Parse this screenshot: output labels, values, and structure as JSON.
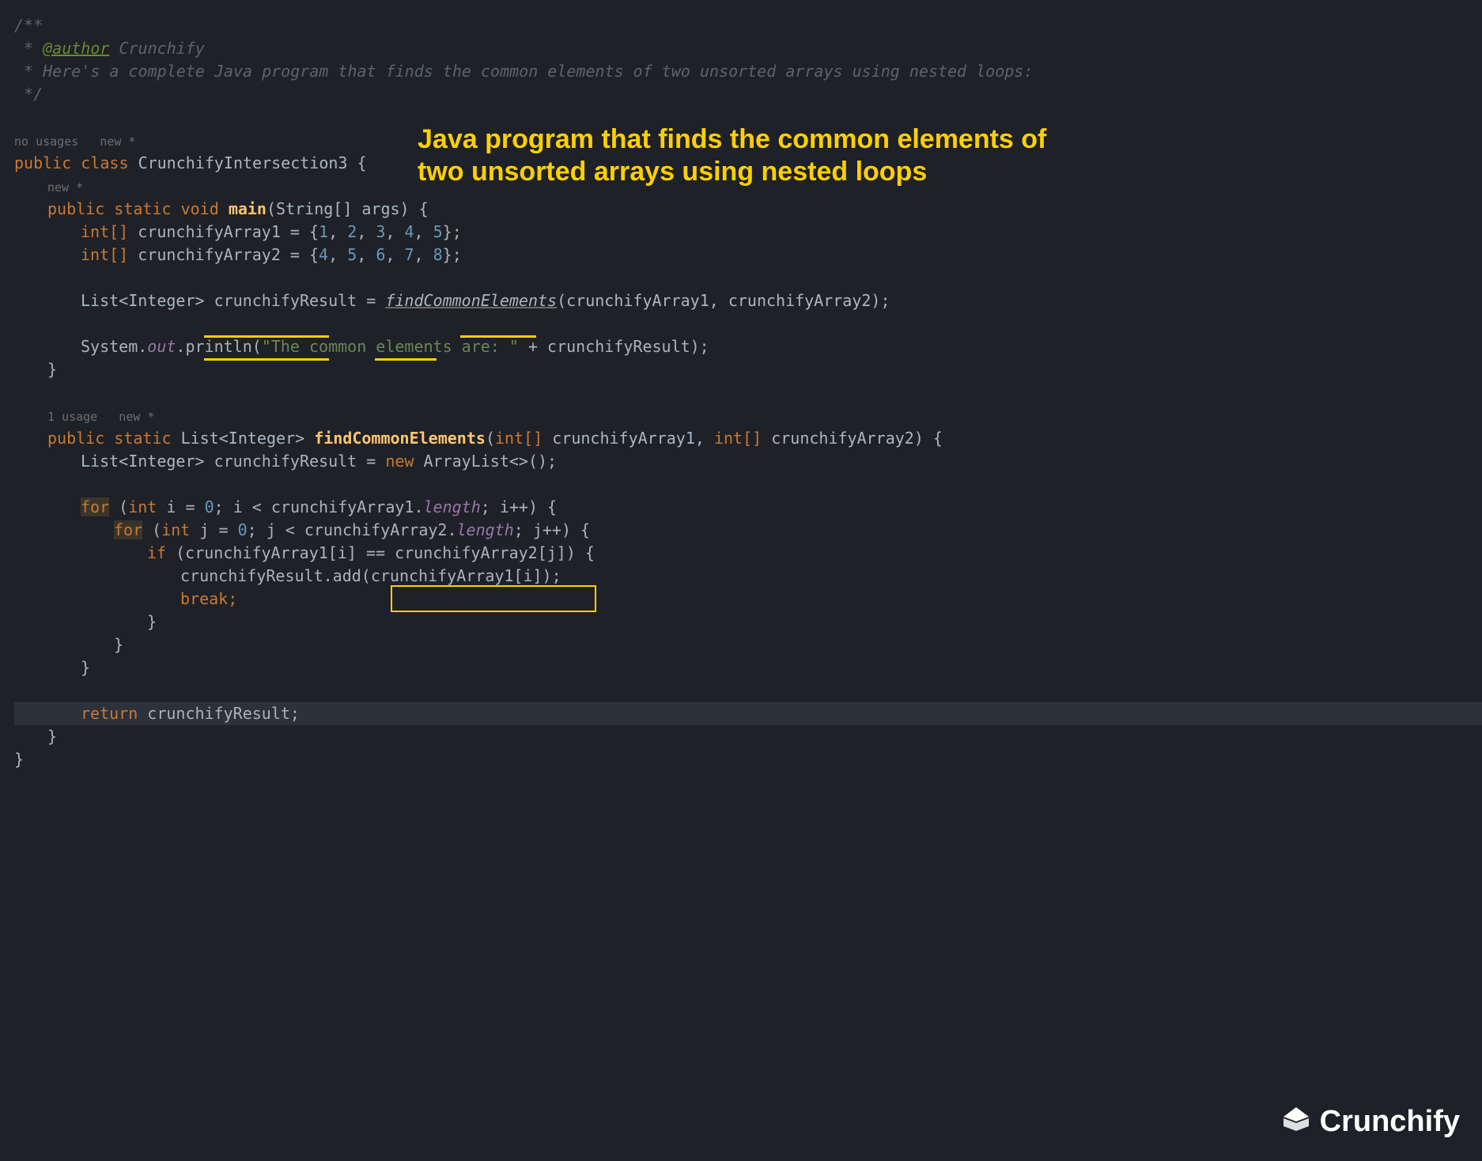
{
  "comment": {
    "start": "/**",
    "author_prefix": " * ",
    "author_tag": "@author",
    "author_name": " Crunchify",
    "desc_line": " * Here's a complete Java program that finds the common elements of two unsorted arrays using nested loops:",
    "end": " */"
  },
  "annotation": {
    "line1": "Java program that finds the common elements of",
    "line2": "two unsorted arrays using nested loops"
  },
  "hints": {
    "class_hint": "no usages   new *",
    "main_hint": "new *",
    "method_hint": "1 usage   new *"
  },
  "code": {
    "public": "public",
    "static": "static",
    "void": "void",
    "class_kw": "class",
    "int_arr": "int[]",
    "int": "int",
    "new": "new",
    "for": "for",
    "if": "if",
    "break": "break;",
    "return": "return",
    "classname": "CrunchifyIntersection3",
    "main": "main",
    "string_args": "(String[] args) {",
    "arr1_name": " crunchifyArray1 = {",
    "arr1_vals": [
      "1",
      "2",
      "3",
      "4",
      "5"
    ],
    "arr2_name": " crunchifyArray2 = {",
    "arr2_vals": [
      "4",
      "5",
      "6",
      "7",
      "8"
    ],
    "list_integer": "List<Integer>",
    "crunchifyResult": " crunchifyResult = ",
    "findCommon": "findCommonElements",
    "call_args": "(crunchifyArray1, crunchifyArray2);",
    "system": "System.",
    "out": "out",
    "println": ".println(",
    "out_string": "\"The common elements are: \"",
    "plus_result": " + crunchifyResult);",
    "method_sig_pre": "(",
    "method_sig_p1": " crunchifyArray1, ",
    "method_sig_p2": " crunchifyArray2) {",
    "result_decl": " crunchifyResult = ",
    "arraylist": " ArrayList<>();",
    "for1_open": " (",
    "for1_init": " i = ",
    "zero": "0",
    "for1_cond": "; i < crunchifyArray1.",
    "length": "length",
    "for1_inc": "; i++) {",
    "for2_init": " j = ",
    "for2_cond": "; j < crunchifyArray2.",
    "for2_inc": "; j++) {",
    "if_cond": " (crunchifyArray1[i] == crunchifyArray2[j]) {",
    "add_call": "crunchifyResult.add(crunchifyArray1[i]);",
    "return_val": " crunchifyResult;",
    "close_brace": "}",
    "open_brace": " {"
  },
  "logo": {
    "text": "Crunchify"
  }
}
